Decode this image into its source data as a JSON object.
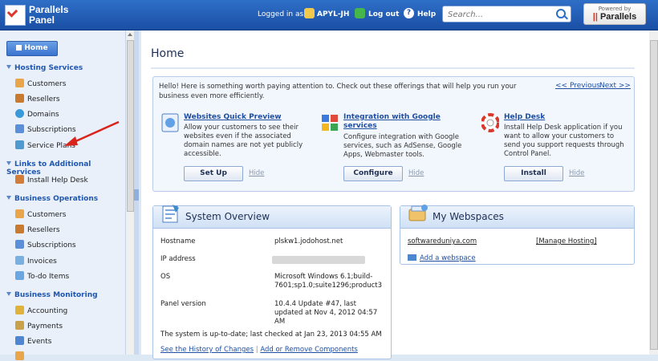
{
  "header": {
    "logo_line1": "Parallels",
    "logo_line2": "Panel",
    "logged_in_label": "Logged in as",
    "username": "APYL-JH",
    "logout_label": "Log out",
    "help_label": "Help",
    "search_placeholder": "Search...",
    "powered_by": "Powered by",
    "powered_brand": "Parallels"
  },
  "sidebar": {
    "home_label": "Home",
    "sections": [
      {
        "title": "Hosting Services",
        "items": [
          "Customers",
          "Resellers",
          "Domains",
          "Subscriptions",
          "Service Plans"
        ]
      },
      {
        "title": "Links to Additional Services",
        "items": [
          "Install Help Desk"
        ]
      },
      {
        "title": "Business Operations",
        "items": [
          "Customers",
          "Resellers",
          "Subscriptions",
          "Invoices",
          "To-do Items"
        ]
      },
      {
        "title": "Business Monitoring",
        "items": [
          "Accounting",
          "Payments",
          "Events"
        ]
      }
    ]
  },
  "main": {
    "title": "Home",
    "promo": {
      "intro": "Hello! Here is something worth paying attention to. Check out these offerings that will help you run your business even more efficiently.",
      "prev": "<< Previous",
      "next": "Next >>",
      "offers": [
        {
          "title": "Websites Quick Preview",
          "desc": "Allow your customers to see their websites even if the associated domain names are not yet publicly accessible.",
          "button": "Set Up",
          "hide": "Hide"
        },
        {
          "title": "Integration with Google services",
          "desc": "Configure integration with Google services, such as AdSense, Google Apps, Webmaster tools.",
          "button": "Configure",
          "hide": "Hide"
        },
        {
          "title": "Help Desk",
          "desc": "Install Help Desk application if you want to allow your customers to send you support requests through Control Panel.",
          "button": "Install",
          "hide": "Hide"
        }
      ]
    },
    "system_overview": {
      "title": "System Overview",
      "hostname_label": "Hostname",
      "hostname": "plskw1.jodohost.net",
      "ip_label": "IP address",
      "os_label": "OS",
      "os_value": "Microsoft Windows 6.1;build-7601;sp1.0;suite1296;product3",
      "panel_version_label": "Panel version",
      "panel_version": "10.4.4 Update #47, last updated at Nov 4, 2012 04:57 AM",
      "status": "The system is up-to-date; last checked at Jan 23, 2013 04:55 AM",
      "history_link": "See the History of Changes",
      "separator": "|",
      "components_link": "Add or Remove Components"
    },
    "my_webspaces": {
      "title": "My Webspaces",
      "domain": "softwareduniya.com",
      "manage": "[Manage Hosting]",
      "add": "Add a webspace"
    }
  },
  "colors": {
    "header_blue": "#1a4fa5",
    "link_blue": "#1f4fa3",
    "section_blue": "#1f56b0",
    "arrow_red": "#d9241c"
  }
}
